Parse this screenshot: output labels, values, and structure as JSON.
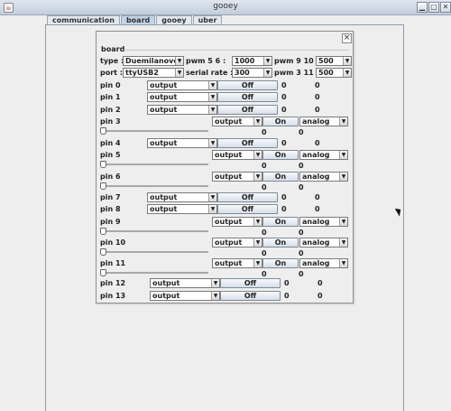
{
  "window": {
    "title": "gooey",
    "icon": "java-cup-icon",
    "controls": [
      "minimize-icon",
      "maximize-icon",
      "close-icon"
    ]
  },
  "tabs": [
    {
      "label": "communication",
      "active": false
    },
    {
      "label": "board",
      "active": true
    },
    {
      "label": "gooey",
      "active": false
    },
    {
      "label": "uber",
      "active": false
    }
  ],
  "board": {
    "group_title": "board",
    "close_glyph": "×",
    "config": {
      "type_label": "type :",
      "type_value": "Duemilanove",
      "pwm56_label": "pwm 5 6 :",
      "pwm56_value": "1000",
      "pwm910_label": "pwm 9 10 :",
      "pwm910_value": "500",
      "port_label": "port :",
      "port_value": "ttyUSB2",
      "serial_label": "serial rate :",
      "serial_value": "300",
      "pwm311_label": "pwm 3 11 :",
      "pwm311_value": "500"
    },
    "pins": [
      {
        "name": "pin 0",
        "kind": "digital",
        "mode": "output",
        "button": "Off",
        "v1": "0",
        "v2": "0"
      },
      {
        "name": "pin 1",
        "kind": "digital",
        "mode": "output",
        "button": "Off",
        "v1": "0",
        "v2": "0"
      },
      {
        "name": "pin 2",
        "kind": "digital",
        "mode": "output",
        "button": "Off",
        "v1": "0",
        "v2": "0"
      },
      {
        "name": "pin 3",
        "kind": "pwm",
        "mode": "output",
        "button": "On",
        "analog": "analog",
        "v1": "0",
        "v2": "0"
      },
      {
        "name": "pin 4",
        "kind": "digital",
        "mode": "output",
        "button": "Off",
        "v1": "0",
        "v2": "0"
      },
      {
        "name": "pin 5",
        "kind": "pwm",
        "mode": "output",
        "button": "On",
        "analog": "analog",
        "v1": "0",
        "v2": "0"
      },
      {
        "name": "pin 6",
        "kind": "pwm",
        "mode": "output",
        "button": "On",
        "analog": "analog",
        "v1": "0",
        "v2": "0"
      },
      {
        "name": "pin 7",
        "kind": "digital",
        "mode": "output",
        "button": "Off",
        "v1": "0",
        "v2": "0"
      },
      {
        "name": "pin 8",
        "kind": "digital",
        "mode": "output",
        "button": "Off",
        "v1": "0",
        "v2": "0"
      },
      {
        "name": "pin 9",
        "kind": "pwm",
        "mode": "output",
        "button": "On",
        "analog": "analog",
        "v1": "0",
        "v2": "0"
      },
      {
        "name": "pin 10",
        "kind": "pwm",
        "mode": "output",
        "button": "On",
        "analog": "analog",
        "v1": "0",
        "v2": "0"
      },
      {
        "name": "pin 11",
        "kind": "pwm",
        "mode": "output",
        "button": "On",
        "analog": "analog",
        "v1": "0",
        "v2": "0"
      },
      {
        "name": "pin 12",
        "kind": "digital",
        "mode": "output",
        "button": "Off",
        "v1": "0",
        "v2": "0"
      },
      {
        "name": "pin 13",
        "kind": "digital",
        "mode": "output",
        "button": "Off",
        "v1": "0",
        "v2": "0"
      }
    ]
  }
}
